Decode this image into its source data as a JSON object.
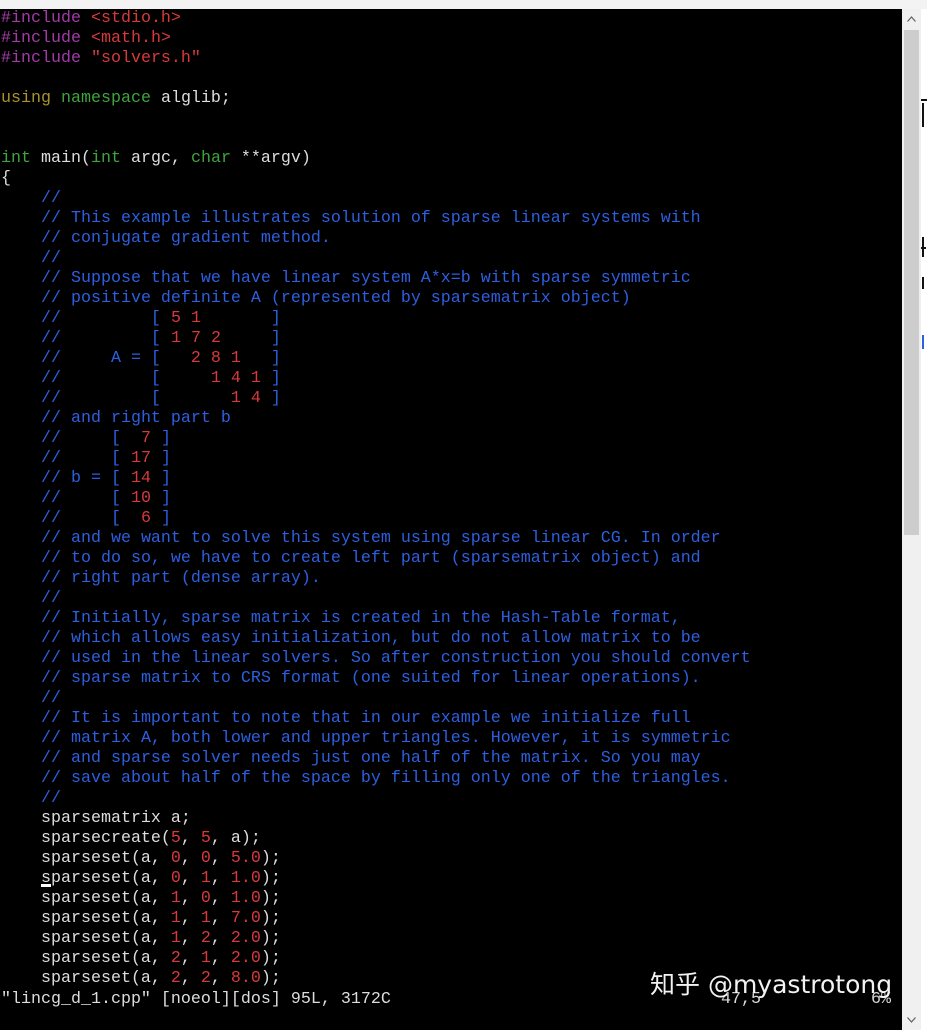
{
  "colors": {
    "n": "#dddddd",
    "cm": "#2d5fe0",
    "num": "#d63a3a",
    "str": "#d63a3a",
    "pp": "#a23ba6",
    "ty": "#3ea43e",
    "st": "#a8932d",
    "background": "#000000"
  },
  "editor": {
    "lines": [
      [
        [
          "#include",
          "pp"
        ],
        [
          " ",
          "n"
        ],
        [
          "<stdio.h>",
          "str"
        ]
      ],
      [
        [
          "#include",
          "pp"
        ],
        [
          " ",
          "n"
        ],
        [
          "<math.h>",
          "str"
        ]
      ],
      [
        [
          "#include",
          "pp"
        ],
        [
          " ",
          "n"
        ],
        [
          "\"solvers.h\"",
          "str"
        ]
      ],
      [],
      [
        [
          "using",
          "st"
        ],
        [
          " ",
          "n"
        ],
        [
          "namespace",
          "ty"
        ],
        [
          " alglib;",
          "n"
        ]
      ],
      [],
      [],
      [
        [
          "int",
          "ty"
        ],
        [
          " main(",
          "n"
        ],
        [
          "int",
          "ty"
        ],
        [
          " argc, ",
          "n"
        ],
        [
          "char",
          "ty"
        ],
        [
          " **argv)",
          "n"
        ]
      ],
      [
        [
          "{",
          "n"
        ]
      ],
      [
        [
          "    ",
          "n"
        ],
        [
          "//",
          "cm"
        ]
      ],
      [
        [
          "    ",
          "n"
        ],
        [
          "// This example illustrates solution of sparse linear systems with",
          "cm"
        ]
      ],
      [
        [
          "    ",
          "n"
        ],
        [
          "// conjugate gradient method.",
          "cm"
        ]
      ],
      [
        [
          "    ",
          "n"
        ],
        [
          "//",
          "cm"
        ]
      ],
      [
        [
          "    ",
          "n"
        ],
        [
          "// Suppose that we have linear system A*x=b with sparse symmetric",
          "cm"
        ]
      ],
      [
        [
          "    ",
          "n"
        ],
        [
          "// positive definite A (represented by sparsematrix object)",
          "cm"
        ]
      ],
      [
        [
          "    ",
          "n"
        ],
        [
          "//         [ ",
          "cm"
        ],
        [
          "5",
          "num"
        ],
        [
          " ",
          "cm"
        ],
        [
          "1",
          "num"
        ],
        [
          "       ]",
          "cm"
        ]
      ],
      [
        [
          "    ",
          "n"
        ],
        [
          "//         [ ",
          "cm"
        ],
        [
          "1",
          "num"
        ],
        [
          " ",
          "cm"
        ],
        [
          "7",
          "num"
        ],
        [
          " ",
          "cm"
        ],
        [
          "2",
          "num"
        ],
        [
          "     ]",
          "cm"
        ]
      ],
      [
        [
          "    ",
          "n"
        ],
        [
          "//     A = [   ",
          "cm"
        ],
        [
          "2",
          "num"
        ],
        [
          " ",
          "cm"
        ],
        [
          "8",
          "num"
        ],
        [
          " ",
          "cm"
        ],
        [
          "1",
          "num"
        ],
        [
          "   ]",
          "cm"
        ]
      ],
      [
        [
          "    ",
          "n"
        ],
        [
          "//         [     ",
          "cm"
        ],
        [
          "1",
          "num"
        ],
        [
          " ",
          "cm"
        ],
        [
          "4",
          "num"
        ],
        [
          " ",
          "cm"
        ],
        [
          "1",
          "num"
        ],
        [
          " ]",
          "cm"
        ]
      ],
      [
        [
          "    ",
          "n"
        ],
        [
          "//         [       ",
          "cm"
        ],
        [
          "1",
          "num"
        ],
        [
          " ",
          "cm"
        ],
        [
          "4",
          "num"
        ],
        [
          " ]",
          "cm"
        ]
      ],
      [
        [
          "    ",
          "n"
        ],
        [
          "// and right part b",
          "cm"
        ]
      ],
      [
        [
          "    ",
          "n"
        ],
        [
          "//     [  ",
          "cm"
        ],
        [
          "7",
          "num"
        ],
        [
          " ]",
          "cm"
        ]
      ],
      [
        [
          "    ",
          "n"
        ],
        [
          "//     [ ",
          "cm"
        ],
        [
          "17",
          "num"
        ],
        [
          " ]",
          "cm"
        ]
      ],
      [
        [
          "    ",
          "n"
        ],
        [
          "// b = [ ",
          "cm"
        ],
        [
          "14",
          "num"
        ],
        [
          " ]",
          "cm"
        ]
      ],
      [
        [
          "    ",
          "n"
        ],
        [
          "//     [ ",
          "cm"
        ],
        [
          "10",
          "num"
        ],
        [
          " ]",
          "cm"
        ]
      ],
      [
        [
          "    ",
          "n"
        ],
        [
          "//     [  ",
          "cm"
        ],
        [
          "6",
          "num"
        ],
        [
          " ]",
          "cm"
        ]
      ],
      [
        [
          "    ",
          "n"
        ],
        [
          "// and we want to solve this system using sparse linear CG. In order",
          "cm"
        ]
      ],
      [
        [
          "    ",
          "n"
        ],
        [
          "// to do so, we have to create left part (sparsematrix object) and",
          "cm"
        ]
      ],
      [
        [
          "    ",
          "n"
        ],
        [
          "// right part (dense array).",
          "cm"
        ]
      ],
      [
        [
          "    ",
          "n"
        ],
        [
          "//",
          "cm"
        ]
      ],
      [
        [
          "    ",
          "n"
        ],
        [
          "// Initially, sparse matrix is created in the Hash-Table format,",
          "cm"
        ]
      ],
      [
        [
          "    ",
          "n"
        ],
        [
          "// which allows easy initialization, but do not allow matrix to be",
          "cm"
        ]
      ],
      [
        [
          "    ",
          "n"
        ],
        [
          "// used in the linear solvers. So after construction you should convert",
          "cm"
        ]
      ],
      [
        [
          "    ",
          "n"
        ],
        [
          "// sparse matrix to CRS format (one suited for linear operations).",
          "cm"
        ]
      ],
      [
        [
          "    ",
          "n"
        ],
        [
          "//",
          "cm"
        ]
      ],
      [
        [
          "    ",
          "n"
        ],
        [
          "// It is important to note that in our example we initialize full",
          "cm"
        ]
      ],
      [
        [
          "    ",
          "n"
        ],
        [
          "// matrix A, both lower and upper triangles. However, it is symmetric",
          "cm"
        ]
      ],
      [
        [
          "    ",
          "n"
        ],
        [
          "// and sparse solver needs just one half of the matrix. So you may",
          "cm"
        ]
      ],
      [
        [
          "    ",
          "n"
        ],
        [
          "// save about half of the space by filling only one of the triangles.",
          "cm"
        ]
      ],
      [
        [
          "    ",
          "n"
        ],
        [
          "//",
          "cm"
        ]
      ],
      [
        [
          "    sparsematrix a;",
          "n"
        ]
      ],
      [
        [
          "    sparsecreate(",
          "n"
        ],
        [
          "5",
          "num"
        ],
        [
          ", ",
          "n"
        ],
        [
          "5",
          "num"
        ],
        [
          ", a);",
          "n"
        ]
      ],
      [
        [
          "    sparseset(a, ",
          "n"
        ],
        [
          "0",
          "num"
        ],
        [
          ", ",
          "n"
        ],
        [
          "0",
          "num"
        ],
        [
          ", ",
          "n"
        ],
        [
          "5.0",
          "num"
        ],
        [
          ");",
          "n"
        ]
      ],
      [
        [
          "    sparseset(a, ",
          "n"
        ],
        [
          "0",
          "num"
        ],
        [
          ", ",
          "n"
        ],
        [
          "1",
          "num"
        ],
        [
          ", ",
          "n"
        ],
        [
          "1.0",
          "num"
        ],
        [
          ");",
          "n"
        ]
      ],
      [
        [
          "    sparseset(a, ",
          "n"
        ],
        [
          "1",
          "num"
        ],
        [
          ", ",
          "n"
        ],
        [
          "0",
          "num"
        ],
        [
          ", ",
          "n"
        ],
        [
          "1.0",
          "num"
        ],
        [
          ");",
          "n"
        ]
      ],
      [
        [
          "    sparseset(a, ",
          "n"
        ],
        [
          "1",
          "num"
        ],
        [
          ", ",
          "n"
        ],
        [
          "1",
          "num"
        ],
        [
          ", ",
          "n"
        ],
        [
          "7.0",
          "num"
        ],
        [
          ");",
          "n"
        ]
      ],
      [
        [
          "    sparseset(a, ",
          "n"
        ],
        [
          "1",
          "num"
        ],
        [
          ", ",
          "n"
        ],
        [
          "2",
          "num"
        ],
        [
          ", ",
          "n"
        ],
        [
          "2.0",
          "num"
        ],
        [
          ");",
          "n"
        ]
      ],
      [
        [
          "    sparseset(a, ",
          "n"
        ],
        [
          "2",
          "num"
        ],
        [
          ", ",
          "n"
        ],
        [
          "1",
          "num"
        ],
        [
          ", ",
          "n"
        ],
        [
          "2.0",
          "num"
        ],
        [
          ");",
          "n"
        ]
      ],
      [
        [
          "    sparseset(a, ",
          "n"
        ],
        [
          "2",
          "num"
        ],
        [
          ", ",
          "n"
        ],
        [
          "2",
          "num"
        ],
        [
          ", ",
          "n"
        ],
        [
          "8.0",
          "num"
        ],
        [
          ");",
          "n"
        ]
      ]
    ]
  },
  "status": {
    "file_info": "\"lincg_d_1.cpp\" [noeol][dos] 95L, 3172C",
    "cursor_pos": "47,5",
    "scroll_pct": "6%"
  },
  "watermark": "知乎 @myastrotong",
  "scrollbar": {
    "up_icon": "scroll-up-arrow",
    "down_icon": "scroll-down-arrow"
  }
}
